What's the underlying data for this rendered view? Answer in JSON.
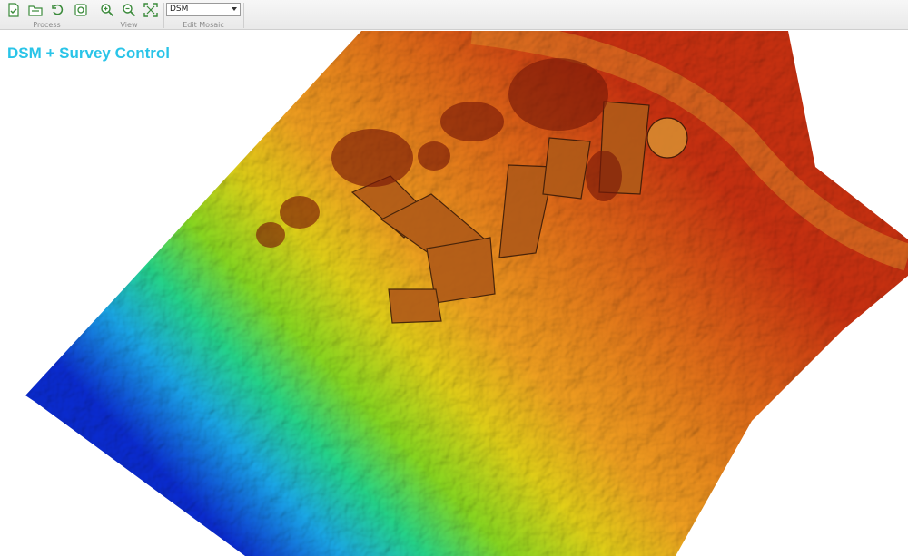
{
  "toolbar": {
    "groups": [
      {
        "caption": "Process"
      },
      {
        "caption": "View"
      },
      {
        "caption": "Edit Mosaic"
      }
    ],
    "mosaic_select": {
      "value": "DSM"
    },
    "icons": {
      "process": [
        "new-project-icon",
        "open-project-icon",
        "rotate-left-icon",
        "refresh-icon"
      ],
      "view": [
        "zoom-in-icon",
        "zoom-out-icon",
        "fit-extent-icon"
      ]
    }
  },
  "map": {
    "title": "DSM + Survey Control",
    "title_color": "#29c4e8",
    "colormap": [
      "#0a2bd0",
      "#1aa8e8",
      "#25d68a",
      "#88d820",
      "#e2d018",
      "#f0a020",
      "#e06a18",
      "#c83010"
    ]
  }
}
